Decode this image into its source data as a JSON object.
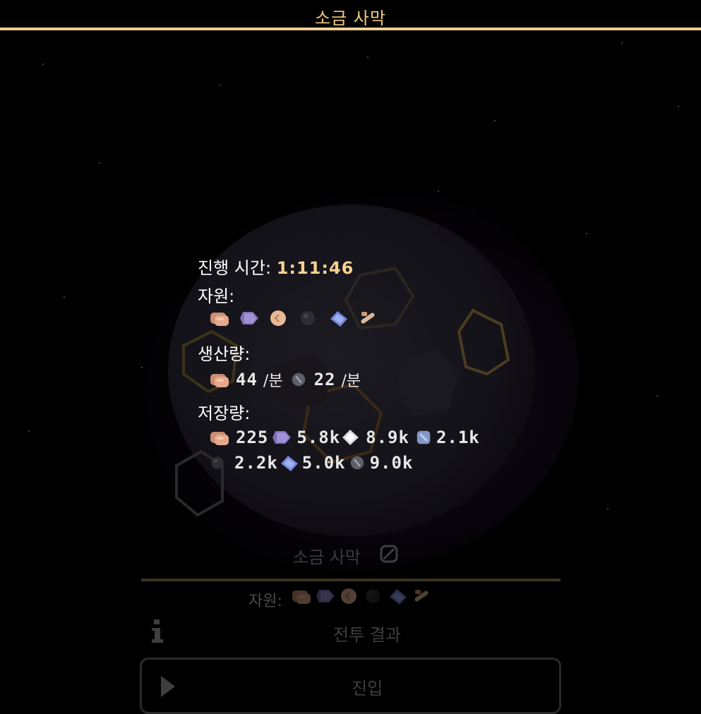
{
  "header": {
    "title": "소금 사막"
  },
  "tooltip": {
    "elapsed_label": "진행 시간:",
    "elapsed_value": "1:11:46",
    "resources_label": "자원:",
    "resources": [
      "copper-ore-icon",
      "purple-crystal-icon",
      "sand-icon",
      "coal-icon",
      "blue-crystal-icon",
      "scrap-icon"
    ],
    "production_label": "생산량:",
    "production": [
      {
        "icon": "copper-ore-icon",
        "value": "44",
        "unit": "/분"
      },
      {
        "icon": "gray-stone-icon",
        "value": "22",
        "unit": "/분"
      }
    ],
    "storage_label": "저장량:",
    "storage": [
      {
        "icon": "copper-ore-icon",
        "value": "225"
      },
      {
        "icon": "purple-crystal-icon",
        "value": "5.8k"
      },
      {
        "icon": "white-crystal-icon",
        "value": "8.9k"
      },
      {
        "icon": "blue-ore-icon",
        "value": "2.1k"
      },
      {
        "icon": "coal-icon",
        "value": "2.2k"
      },
      {
        "icon": "blue-crystal-icon",
        "value": "5.0k"
      },
      {
        "icon": "gray-stone-icon",
        "value": "9.0k"
      }
    ]
  },
  "panel": {
    "title": "소금 사막",
    "resources_label": "자원:",
    "battle_results": "전투 결과",
    "enter": "진입"
  },
  "colors": {
    "accent": "#f0cf92",
    "gold_text": "#f6d28f",
    "background": "#000000"
  }
}
